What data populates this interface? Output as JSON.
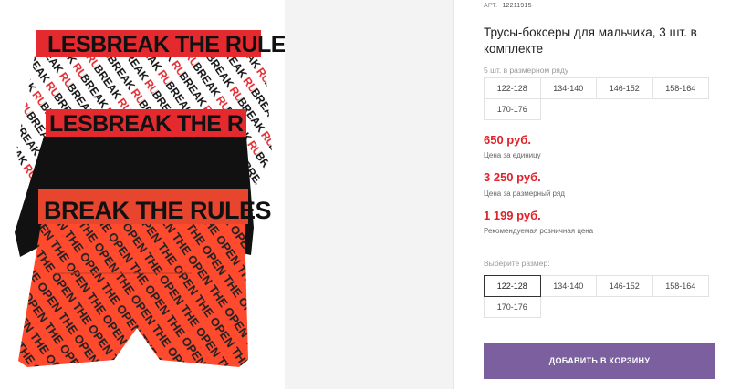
{
  "product": {
    "art_label": "АРТ.",
    "art_number": "12211915",
    "title": "Трусы-боксеры для мальчика, 3 шт. в комплекте",
    "image": {
      "brief_print_text": "BREAK THE RULES",
      "print_text_2": "OPEN YOUR MIND",
      "colors": {
        "white": "#ffffff",
        "black": "#111111",
        "red": "#ff4a2e",
        "band_red": "#e42a2f"
      }
    }
  },
  "size_row": {
    "label": "5 шт. в размерном ряду",
    "sizes": [
      "122-128",
      "134-140",
      "146-152",
      "158-164",
      "170-176"
    ]
  },
  "prices": {
    "unit_price": "650 руб.",
    "unit_note": "Цена за единицу",
    "row_price": "3 250 руб.",
    "row_note": "Цена за размерный ряд",
    "retail_price": "1 199 руб.",
    "retail_note": "Рекомендуемая розничная цена"
  },
  "size_select": {
    "label": "Выберите размер:",
    "sizes": [
      "122-128",
      "134-140",
      "146-152",
      "158-164",
      "170-176"
    ],
    "selected": "122-128"
  },
  "cart": {
    "label": "ДОБАВИТЬ В КОРЗИНУ",
    "color": "#7b5f9e"
  }
}
